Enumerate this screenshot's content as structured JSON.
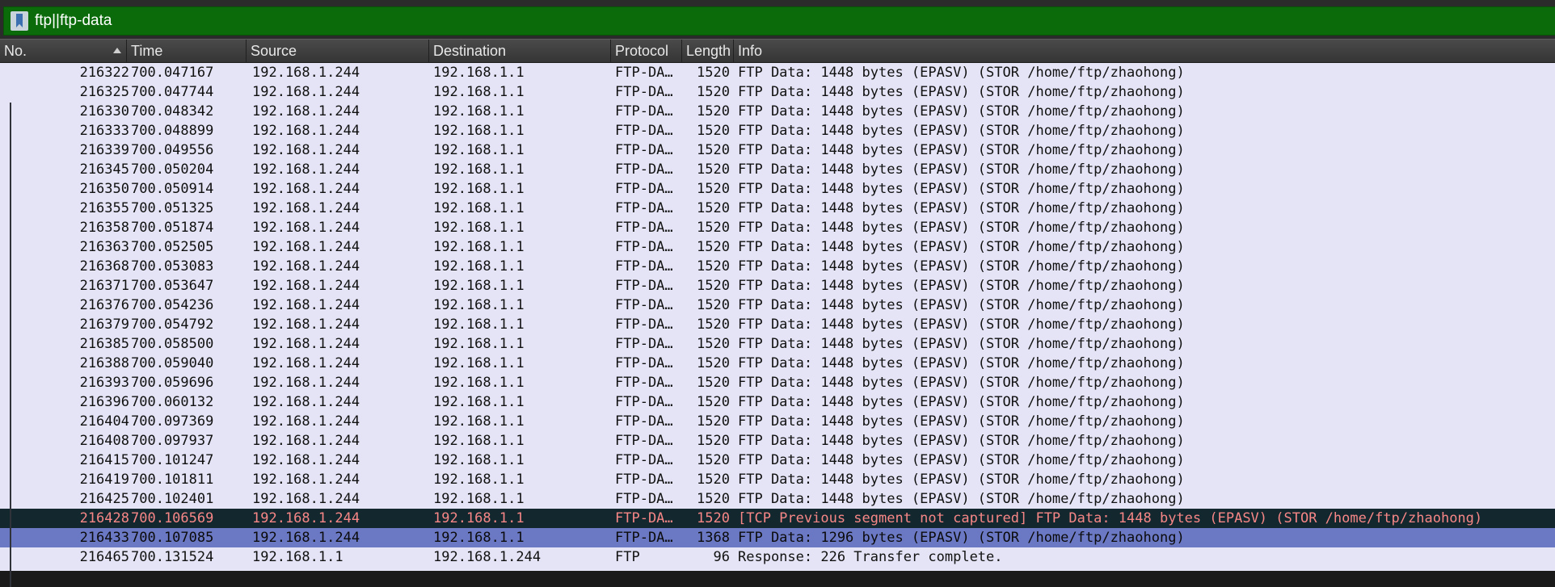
{
  "filter": {
    "value": "ftp||ftp-data"
  },
  "columns": [
    "No.",
    "Time",
    "Source",
    "Destination",
    "Protocol",
    "Length",
    "Info"
  ],
  "packets": [
    {
      "no": "216322",
      "time": "700.047167",
      "src": "192.168.1.244",
      "dst": "192.168.1.1",
      "proto": "FTP-DA…",
      "len": "1520",
      "info": "FTP Data: 1448 bytes (EPASV) (STOR /home/ftp/zhaohong)",
      "state": "normal"
    },
    {
      "no": "216325",
      "time": "700.047744",
      "src": "192.168.1.244",
      "dst": "192.168.1.1",
      "proto": "FTP-DA…",
      "len": "1520",
      "info": "FTP Data: 1448 bytes (EPASV) (STOR /home/ftp/zhaohong)",
      "state": "normal"
    },
    {
      "no": "216330",
      "time": "700.048342",
      "src": "192.168.1.244",
      "dst": "192.168.1.1",
      "proto": "FTP-DA…",
      "len": "1520",
      "info": "FTP Data: 1448 bytes (EPASV) (STOR /home/ftp/zhaohong)",
      "state": "normal"
    },
    {
      "no": "216333",
      "time": "700.048899",
      "src": "192.168.1.244",
      "dst": "192.168.1.1",
      "proto": "FTP-DA…",
      "len": "1520",
      "info": "FTP Data: 1448 bytes (EPASV) (STOR /home/ftp/zhaohong)",
      "state": "normal"
    },
    {
      "no": "216339",
      "time": "700.049556",
      "src": "192.168.1.244",
      "dst": "192.168.1.1",
      "proto": "FTP-DA…",
      "len": "1520",
      "info": "FTP Data: 1448 bytes (EPASV) (STOR /home/ftp/zhaohong)",
      "state": "normal"
    },
    {
      "no": "216345",
      "time": "700.050204",
      "src": "192.168.1.244",
      "dst": "192.168.1.1",
      "proto": "FTP-DA…",
      "len": "1520",
      "info": "FTP Data: 1448 bytes (EPASV) (STOR /home/ftp/zhaohong)",
      "state": "normal"
    },
    {
      "no": "216350",
      "time": "700.050914",
      "src": "192.168.1.244",
      "dst": "192.168.1.1",
      "proto": "FTP-DA…",
      "len": "1520",
      "info": "FTP Data: 1448 bytes (EPASV) (STOR /home/ftp/zhaohong)",
      "state": "normal"
    },
    {
      "no": "216355",
      "time": "700.051325",
      "src": "192.168.1.244",
      "dst": "192.168.1.1",
      "proto": "FTP-DA…",
      "len": "1520",
      "info": "FTP Data: 1448 bytes (EPASV) (STOR /home/ftp/zhaohong)",
      "state": "normal"
    },
    {
      "no": "216358",
      "time": "700.051874",
      "src": "192.168.1.244",
      "dst": "192.168.1.1",
      "proto": "FTP-DA…",
      "len": "1520",
      "info": "FTP Data: 1448 bytes (EPASV) (STOR /home/ftp/zhaohong)",
      "state": "normal"
    },
    {
      "no": "216363",
      "time": "700.052505",
      "src": "192.168.1.244",
      "dst": "192.168.1.1",
      "proto": "FTP-DA…",
      "len": "1520",
      "info": "FTP Data: 1448 bytes (EPASV) (STOR /home/ftp/zhaohong)",
      "state": "normal"
    },
    {
      "no": "216368",
      "time": "700.053083",
      "src": "192.168.1.244",
      "dst": "192.168.1.1",
      "proto": "FTP-DA…",
      "len": "1520",
      "info": "FTP Data: 1448 bytes (EPASV) (STOR /home/ftp/zhaohong)",
      "state": "normal"
    },
    {
      "no": "216371",
      "time": "700.053647",
      "src": "192.168.1.244",
      "dst": "192.168.1.1",
      "proto": "FTP-DA…",
      "len": "1520",
      "info": "FTP Data: 1448 bytes (EPASV) (STOR /home/ftp/zhaohong)",
      "state": "normal"
    },
    {
      "no": "216376",
      "time": "700.054236",
      "src": "192.168.1.244",
      "dst": "192.168.1.1",
      "proto": "FTP-DA…",
      "len": "1520",
      "info": "FTP Data: 1448 bytes (EPASV) (STOR /home/ftp/zhaohong)",
      "state": "normal"
    },
    {
      "no": "216379",
      "time": "700.054792",
      "src": "192.168.1.244",
      "dst": "192.168.1.1",
      "proto": "FTP-DA…",
      "len": "1520",
      "info": "FTP Data: 1448 bytes (EPASV) (STOR /home/ftp/zhaohong)",
      "state": "normal"
    },
    {
      "no": "216385",
      "time": "700.058500",
      "src": "192.168.1.244",
      "dst": "192.168.1.1",
      "proto": "FTP-DA…",
      "len": "1520",
      "info": "FTP Data: 1448 bytes (EPASV) (STOR /home/ftp/zhaohong)",
      "state": "normal"
    },
    {
      "no": "216388",
      "time": "700.059040",
      "src": "192.168.1.244",
      "dst": "192.168.1.1",
      "proto": "FTP-DA…",
      "len": "1520",
      "info": "FTP Data: 1448 bytes (EPASV) (STOR /home/ftp/zhaohong)",
      "state": "normal"
    },
    {
      "no": "216393",
      "time": "700.059696",
      "src": "192.168.1.244",
      "dst": "192.168.1.1",
      "proto": "FTP-DA…",
      "len": "1520",
      "info": "FTP Data: 1448 bytes (EPASV) (STOR /home/ftp/zhaohong)",
      "state": "normal"
    },
    {
      "no": "216396",
      "time": "700.060132",
      "src": "192.168.1.244",
      "dst": "192.168.1.1",
      "proto": "FTP-DA…",
      "len": "1520",
      "info": "FTP Data: 1448 bytes (EPASV) (STOR /home/ftp/zhaohong)",
      "state": "normal"
    },
    {
      "no": "216404",
      "time": "700.097369",
      "src": "192.168.1.244",
      "dst": "192.168.1.1",
      "proto": "FTP-DA…",
      "len": "1520",
      "info": "FTP Data: 1448 bytes (EPASV) (STOR /home/ftp/zhaohong)",
      "state": "normal"
    },
    {
      "no": "216408",
      "time": "700.097937",
      "src": "192.168.1.244",
      "dst": "192.168.1.1",
      "proto": "FTP-DA…",
      "len": "1520",
      "info": "FTP Data: 1448 bytes (EPASV) (STOR /home/ftp/zhaohong)",
      "state": "normal"
    },
    {
      "no": "216415",
      "time": "700.101247",
      "src": "192.168.1.244",
      "dst": "192.168.1.1",
      "proto": "FTP-DA…",
      "len": "1520",
      "info": "FTP Data: 1448 bytes (EPASV) (STOR /home/ftp/zhaohong)",
      "state": "normal"
    },
    {
      "no": "216419",
      "time": "700.101811",
      "src": "192.168.1.244",
      "dst": "192.168.1.1",
      "proto": "FTP-DA…",
      "len": "1520",
      "info": "FTP Data: 1448 bytes (EPASV) (STOR /home/ftp/zhaohong)",
      "state": "normal"
    },
    {
      "no": "216425",
      "time": "700.102401",
      "src": "192.168.1.244",
      "dst": "192.168.1.1",
      "proto": "FTP-DA…",
      "len": "1520",
      "info": "FTP Data: 1448 bytes (EPASV) (STOR /home/ftp/zhaohong)",
      "state": "normal"
    },
    {
      "no": "216428",
      "time": "700.106569",
      "src": "192.168.1.244",
      "dst": "192.168.1.1",
      "proto": "FTP-DA…",
      "len": "1520",
      "info": "[TCP Previous segment not captured] FTP Data: 1448 bytes (EPASV) (STOR /home/ftp/zhaohong)",
      "state": "bad"
    },
    {
      "no": "216433",
      "time": "700.107085",
      "src": "192.168.1.244",
      "dst": "192.168.1.1",
      "proto": "FTP-DA…",
      "len": "1368",
      "info": "FTP Data: 1296 bytes (EPASV) (STOR /home/ftp/zhaohong)",
      "state": "selected"
    },
    {
      "no": "216465",
      "time": "700.131524",
      "src": "192.168.1.1",
      "dst": "192.168.1.244",
      "proto": "FTP",
      "len": "96",
      "info": "Response: 226 Transfer complete.",
      "state": "ftp"
    }
  ],
  "colors": {
    "filter_valid_bg": "#0b6b0b",
    "row_bg": "#e4e4f6",
    "bad_row_bg": "#12272e",
    "bad_row_fg": "#f78787",
    "selected_row_bg": "#6b78c4"
  },
  "icons": {
    "filter_bookmark": "bookmark-icon",
    "sort_ascending": "sort-ascending-icon"
  }
}
